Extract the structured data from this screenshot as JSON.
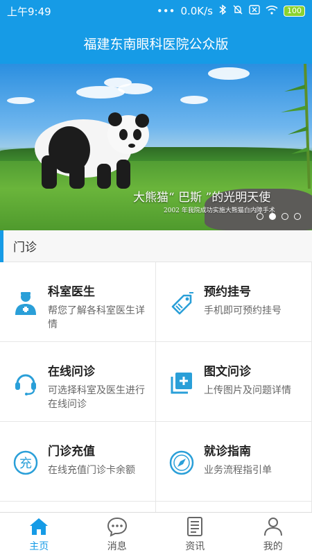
{
  "status_bar": {
    "time": "上午9:49",
    "dots": "•••",
    "speed": "0.0K/s",
    "battery": "100"
  },
  "header": {
    "title": "福建东南眼科医院公众版"
  },
  "banner": {
    "caption": "大熊猫“ 巴斯 ”的光明天使",
    "subcaption": "2002 年我院成功实施大熊猫白内障手术",
    "slide_count": 4,
    "active_slide": 2
  },
  "section": {
    "title": "门诊"
  },
  "services": [
    {
      "title": "科室医生",
      "desc": "帮您了解各科室医生详情",
      "icon": "doctor-icon"
    },
    {
      "title": "预约挂号",
      "desc": "手机即可预约挂号",
      "icon": "tag-icon"
    },
    {
      "title": "在线问诊",
      "desc": "可选择科室及医生进行在线问诊",
      "icon": "headset-icon"
    },
    {
      "title": "图文问诊",
      "desc": "上传图片及问题详情",
      "icon": "image-add-icon"
    },
    {
      "title": "门诊充值",
      "desc": "在线充值门诊卡余额",
      "icon": "recharge-icon"
    },
    {
      "title": "就诊指南",
      "desc": "业务流程指引单",
      "icon": "compass-icon"
    }
  ],
  "tabs": [
    {
      "label": "主页",
      "icon": "home-icon",
      "active": true
    },
    {
      "label": "消息",
      "icon": "chat-icon",
      "active": false
    },
    {
      "label": "资讯",
      "icon": "news-icon",
      "active": false
    },
    {
      "label": "我的",
      "icon": "user-icon",
      "active": false
    }
  ],
  "colors": {
    "primary": "#169be6",
    "icon": "#2a9fd8"
  }
}
